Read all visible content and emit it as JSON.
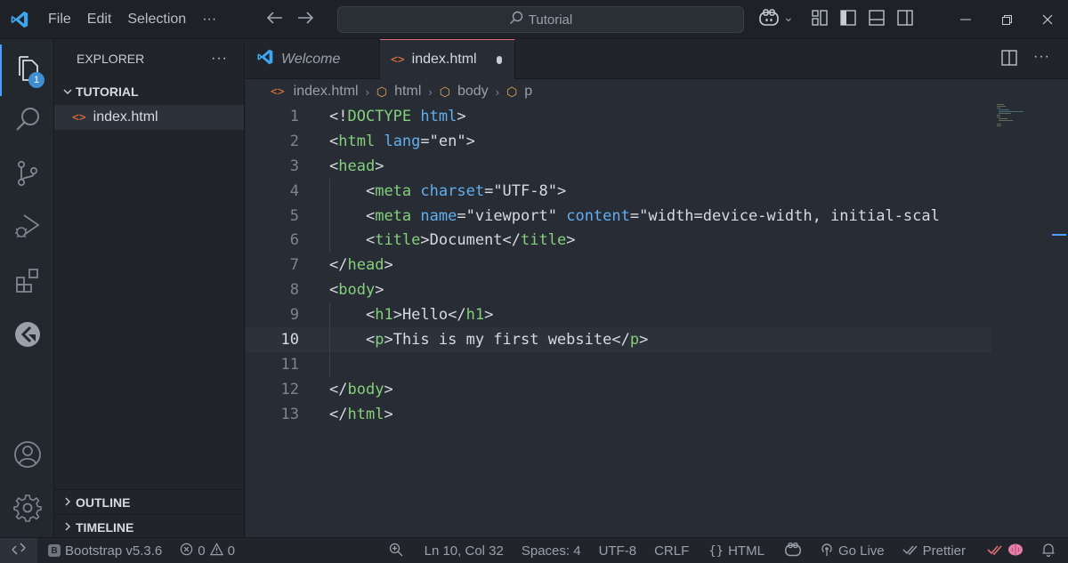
{
  "titlebar": {
    "menu": [
      "File",
      "Edit",
      "Selection",
      "···"
    ],
    "search_text": "Tutorial",
    "copilot_chevron": "⌄"
  },
  "activity": {
    "explorer_badge": "1"
  },
  "sidebar": {
    "title": "EXPLORER",
    "more": "···",
    "folder_name": "TUTORIAL",
    "file_name": "index.html",
    "file_icon": "<>",
    "outline_label": "OUTLINE",
    "timeline_label": "TIMELINE"
  },
  "tabs": {
    "welcome": "Welcome",
    "index": "index.html",
    "file_icon": "<>"
  },
  "breadcrumb": {
    "file": "index.html",
    "items": [
      "html",
      "body",
      "p"
    ]
  },
  "code": {
    "current_line": 10,
    "lines": [
      [
        [
          "t-br",
          "<!"
        ],
        [
          "t-tag",
          "DOCTYPE"
        ],
        [
          "t-txt",
          " "
        ],
        [
          "t-attr",
          "html"
        ],
        [
          "t-br",
          ">"
        ]
      ],
      [
        [
          "t-br",
          "<"
        ],
        [
          "t-tag",
          "html"
        ],
        [
          "t-txt",
          " "
        ],
        [
          "t-attr",
          "lang"
        ],
        [
          "t-txt",
          "="
        ],
        [
          "t-str",
          "\"en\""
        ],
        [
          "t-br",
          ">"
        ]
      ],
      [
        [
          "t-br",
          "<"
        ],
        [
          "t-tag",
          "head"
        ],
        [
          "t-br",
          ">"
        ]
      ],
      [
        [
          "t-txt",
          "    "
        ],
        [
          "t-br",
          "<"
        ],
        [
          "t-tag",
          "meta"
        ],
        [
          "t-txt",
          " "
        ],
        [
          "t-attr",
          "charset"
        ],
        [
          "t-txt",
          "="
        ],
        [
          "t-str",
          "\"UTF-8\""
        ],
        [
          "t-br",
          ">"
        ]
      ],
      [
        [
          "t-txt",
          "    "
        ],
        [
          "t-br",
          "<"
        ],
        [
          "t-tag",
          "meta"
        ],
        [
          "t-txt",
          " "
        ],
        [
          "t-attr",
          "name"
        ],
        [
          "t-txt",
          "="
        ],
        [
          "t-str",
          "\"viewport\""
        ],
        [
          "t-txt",
          " "
        ],
        [
          "t-attr",
          "content"
        ],
        [
          "t-txt",
          "="
        ],
        [
          "t-str",
          "\"width=device-width, initial-scal"
        ]
      ],
      [
        [
          "t-txt",
          "    "
        ],
        [
          "t-br",
          "<"
        ],
        [
          "t-tag",
          "title"
        ],
        [
          "t-br",
          ">"
        ],
        [
          "t-txt",
          "Document"
        ],
        [
          "t-br",
          "</"
        ],
        [
          "t-tag",
          "title"
        ],
        [
          "t-br",
          ">"
        ]
      ],
      [
        [
          "t-br",
          "</"
        ],
        [
          "t-tag",
          "head"
        ],
        [
          "t-br",
          ">"
        ]
      ],
      [
        [
          "t-br",
          "<"
        ],
        [
          "t-tag",
          "body"
        ],
        [
          "t-br",
          ">"
        ]
      ],
      [
        [
          "t-txt",
          "    "
        ],
        [
          "t-br",
          "<"
        ],
        [
          "t-tag",
          "h1"
        ],
        [
          "t-br",
          ">"
        ],
        [
          "t-txt",
          "Hello"
        ],
        [
          "t-br",
          "</"
        ],
        [
          "t-tag",
          "h1"
        ],
        [
          "t-br",
          ">"
        ]
      ],
      [
        [
          "t-txt",
          "    "
        ],
        [
          "t-br",
          "<"
        ],
        [
          "t-tag",
          "p"
        ],
        [
          "t-br",
          ">"
        ],
        [
          "t-txt",
          "This is my first website"
        ],
        [
          "t-br",
          "</"
        ],
        [
          "t-tag",
          "p"
        ],
        [
          "t-br",
          ">"
        ]
      ],
      [],
      [
        [
          "t-br",
          "</"
        ],
        [
          "t-tag",
          "body"
        ],
        [
          "t-br",
          ">"
        ]
      ],
      [
        [
          "t-br",
          "</"
        ],
        [
          "t-tag",
          "html"
        ],
        [
          "t-br",
          ">"
        ]
      ]
    ]
  },
  "statusbar": {
    "bootstrap": "Bootstrap v5.3.6",
    "errors": "0",
    "warnings": "0",
    "position": "Ln 10, Col 32",
    "spaces": "Spaces: 4",
    "encoding": "UTF-8",
    "eol": "CRLF",
    "language": "HTML",
    "go_live": "Go Live",
    "prettier": "Prettier"
  }
}
